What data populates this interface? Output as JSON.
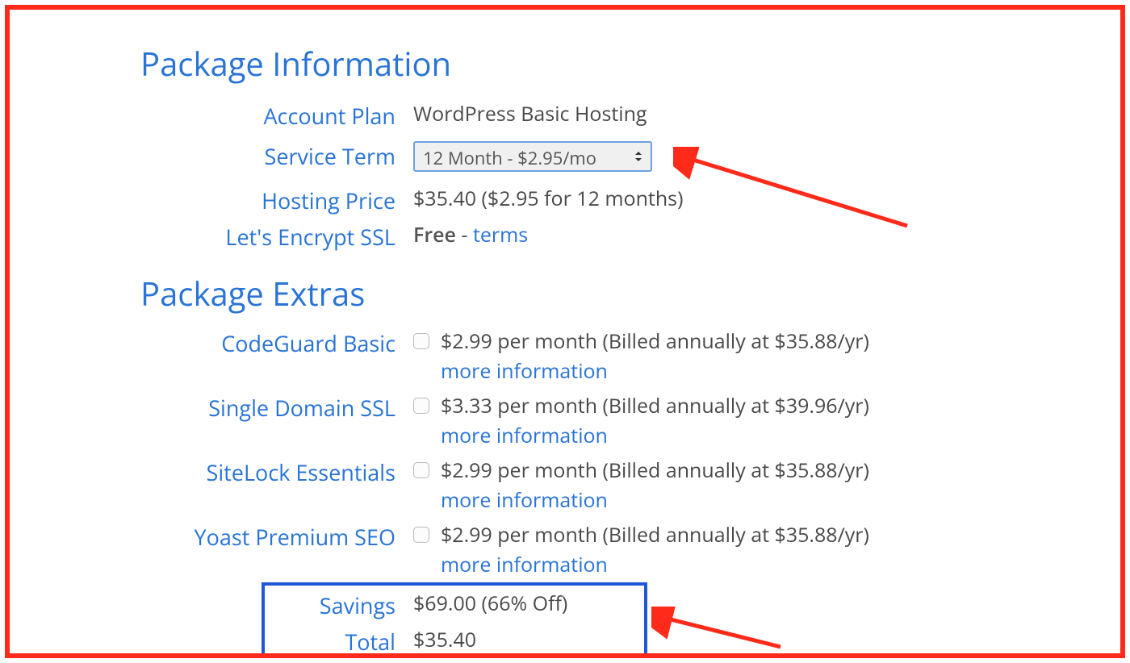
{
  "sections": {
    "package_info_title": "Package Information",
    "package_extras_title": "Package Extras"
  },
  "package_info": {
    "account_plan_label": "Account Plan",
    "account_plan_value": "WordPress Basic Hosting",
    "service_term_label": "Service Term",
    "service_term_selected": "12 Month - $2.95/mo",
    "hosting_price_label": "Hosting Price",
    "hosting_price_value": "$35.40 ($2.95 for 12 months)",
    "ssl_label": "Let's Encrypt SSL",
    "ssl_free": "Free",
    "ssl_sep": " - ",
    "ssl_terms": "terms"
  },
  "extras": {
    "codeguard_label": "CodeGuard Basic",
    "codeguard_value": "$2.99 per month (Billed annually at $35.88/yr)",
    "single_ssl_label": "Single Domain SSL",
    "single_ssl_value": "$3.33 per month (Billed annually at $39.96/yr)",
    "sitelock_label": "SiteLock Essentials",
    "sitelock_value": "$2.99 per month (Billed annually at $35.88/yr)",
    "yoast_label": "Yoast Premium SEO",
    "yoast_value": "$2.99 per month (Billed annually at $35.88/yr)",
    "more_info": "more information"
  },
  "totals": {
    "savings_label": "Savings",
    "savings_value": "$69.00 (66% Off)",
    "total_label": "Total",
    "total_value": "$35.40"
  },
  "colors": {
    "frame": "#ff2a19",
    "primary": "#2974d6",
    "box": "#1f57d6"
  }
}
